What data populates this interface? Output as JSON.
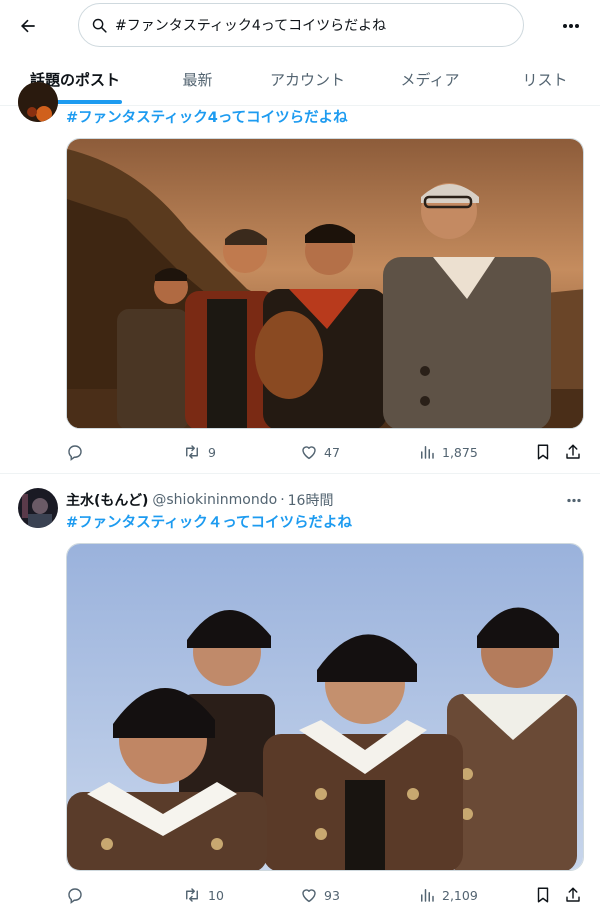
{
  "header": {
    "search_value": "#ファンタスティック4ってコイツらだよね",
    "tabs": [
      {
        "label": "話題のポスト",
        "active": true
      },
      {
        "label": "最新",
        "active": false
      },
      {
        "label": "アカウント",
        "active": false
      },
      {
        "label": "メディア",
        "active": false
      },
      {
        "label": "リスト",
        "active": false
      }
    ]
  },
  "tweets": [
    {
      "hashtag": "#ファンタスティック4ってコイツらだよね",
      "replies": "",
      "reposts": "9",
      "likes": "47",
      "views": "1,875"
    },
    {
      "display_name": "主水(もんど)",
      "handle": "@shiokininmondo",
      "separator": "·",
      "time": "16時間",
      "hashtag": "#ファンタスティック４ってコイツらだよね",
      "replies": "",
      "reposts": "10",
      "likes": "93",
      "views": "2,109"
    }
  ],
  "colors": {
    "accent": "#1d9bf0",
    "text": "#0f1419",
    "muted": "#536471",
    "border": "#eff3f4"
  },
  "icons": [
    "back-arrow-icon",
    "search-icon",
    "more-icon",
    "reply-icon",
    "repost-icon",
    "like-icon",
    "views-icon",
    "bookmark-icon",
    "share-icon"
  ]
}
